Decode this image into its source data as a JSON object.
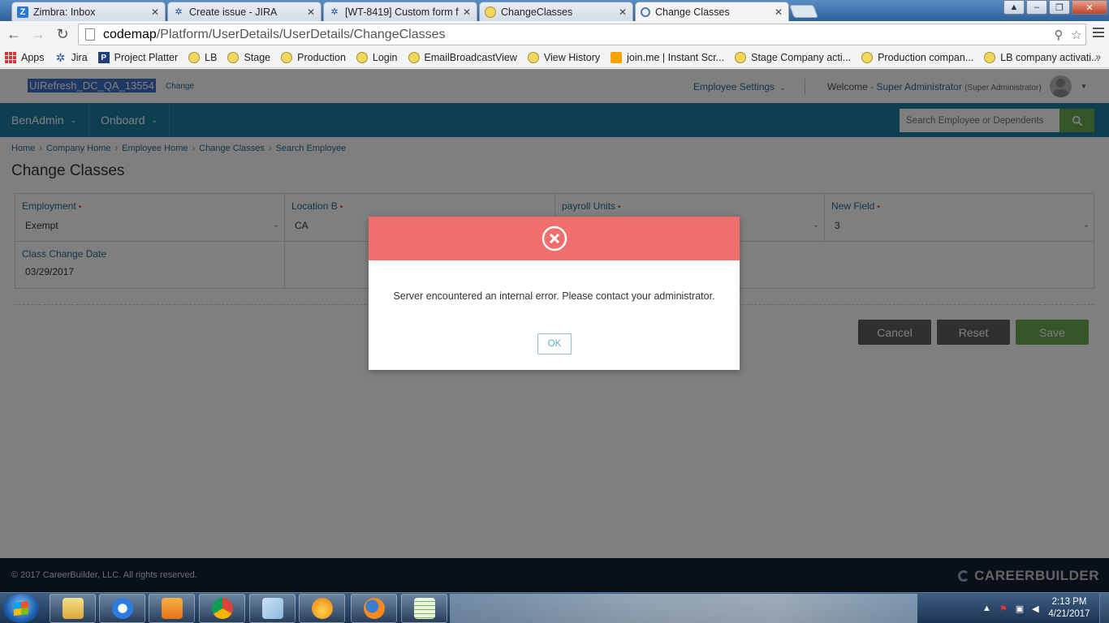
{
  "browser": {
    "tabs": [
      {
        "title": "Zimbra: Inbox",
        "icon": "zimbra-icon"
      },
      {
        "title": "Create issue - JIRA",
        "icon": "jira-icon"
      },
      {
        "title": "[WT-8419] Custom form fi",
        "icon": "jira-icon"
      },
      {
        "title": "ChangeClasses",
        "icon": "yellow-globe-icon"
      },
      {
        "title": "Change Classes",
        "icon": "chrome-page-icon"
      }
    ],
    "address": {
      "host": "codemap",
      "path": "/Platform/UserDetails/UserDetails/ChangeClasses"
    },
    "bookmarks": [
      {
        "label": "Apps",
        "icon": "apps-grid-icon"
      },
      {
        "label": "Jira",
        "icon": "jira-icon"
      },
      {
        "label": "Project Platter",
        "icon": "p-icon"
      },
      {
        "label": "LB",
        "icon": "yellow-globe-icon"
      },
      {
        "label": "Stage",
        "icon": "yellow-globe-icon"
      },
      {
        "label": "Production",
        "icon": "yellow-globe-icon"
      },
      {
        "label": "Login",
        "icon": "yellow-globe-icon"
      },
      {
        "label": "EmailBroadcastView",
        "icon": "yellow-globe-icon"
      },
      {
        "label": "View History",
        "icon": "yellow-globe-icon"
      },
      {
        "label": "join.me | Instant Scr...",
        "icon": "joinme-icon"
      },
      {
        "label": "Stage Company acti...",
        "icon": "yellow-globe-icon"
      },
      {
        "label": "Production compan...",
        "icon": "yellow-globe-icon"
      },
      {
        "label": "LB company activati...",
        "icon": "yellow-globe-icon"
      }
    ],
    "bookmarks_more": "»"
  },
  "header": {
    "company": "UIRefresh_DC_QA_13554",
    "change_link": "Change",
    "employee_settings": "Employee Settings",
    "welcome_prefix": "Welcome - ",
    "user_name": "Super Administrator",
    "user_role": "(Super Administrator)"
  },
  "nav": {
    "items": [
      {
        "label": "BenAdmin"
      },
      {
        "label": "Onboard"
      }
    ],
    "search_placeholder": "Search Employee or Dependents"
  },
  "breadcrumb": [
    "Home",
    "Company Home",
    "Employee Home",
    "Change Classes",
    "Search Employee"
  ],
  "page_title": "Change Classes",
  "form": {
    "employment": {
      "label": "Employment",
      "value": "Exempt"
    },
    "location": {
      "label": "Location B",
      "value": "CA"
    },
    "payroll": {
      "label": "payroll Units",
      "value": ""
    },
    "new_field": {
      "label": "New Field",
      "value": "3"
    },
    "class_change_date": {
      "label": "Class Change Date",
      "value": "03/29/2017"
    },
    "required_mark": "•"
  },
  "actions": {
    "cancel": "Cancel",
    "reset": "Reset",
    "save": "Save"
  },
  "footer": {
    "copyright": "© 2017 CareerBuilder, LLC. All rights reserved.",
    "brand": "CAREERBUILDER"
  },
  "modal": {
    "message": "Server encountered an internal error. Please contact your administrator.",
    "ok": "OK",
    "header_color": "#f06e6b"
  },
  "taskbar": {
    "time": "2:13 PM",
    "date": "4/21/2017"
  },
  "colors": {
    "navbar": "#1d7fa2",
    "accent_green": "#6aa84f",
    "link": "#2a6b91"
  }
}
